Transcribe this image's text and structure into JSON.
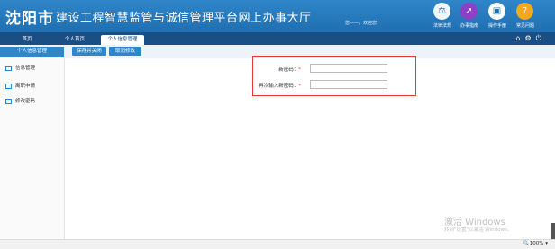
{
  "header": {
    "brand": "沈阳市",
    "title": "建设工程智慧监管与诚信管理平台网上办事大厅",
    "welcome": "您——，欢迎您！",
    "icons": [
      {
        "name": "scale-icon",
        "glyph": "⚖",
        "label": "法律法规",
        "color": "#f0f6fc",
        "glyph_color": "#1f6fb2"
      },
      {
        "name": "compass-icon",
        "glyph": "➚",
        "label": "办事指南",
        "color": "#8e3fc7",
        "glyph_color": "#ffffff"
      },
      {
        "name": "book-icon",
        "glyph": "▣",
        "label": "操作手册",
        "color": "#ffffff",
        "glyph_color": "#1f6fb2"
      },
      {
        "name": "question-icon",
        "glyph": "?",
        "label": "常见问题",
        "color": "#f4a81c",
        "glyph_color": "#ffffff"
      }
    ]
  },
  "nav": {
    "tabs": [
      "首页",
      "个人首页",
      "个人信息管理"
    ],
    "active_tab": "个人信息管理",
    "icons": [
      "home-icon",
      "gear-icon",
      "power-icon"
    ]
  },
  "sidebar": {
    "title": "个人信息管理",
    "items": [
      "信息管理",
      "离职申请",
      "修改密码"
    ]
  },
  "toolbar": {
    "save_label": "保存并关闭",
    "cancel_label": "取消修改"
  },
  "form": {
    "new_password_label": "新密码：",
    "confirm_password_label": "再次输入新密码：",
    "required_mark": "*",
    "new_password_value": "",
    "confirm_password_value": ""
  },
  "watermark": {
    "line1": "激活 Windows",
    "line2": "转到\"设置\"以激活 Windows。"
  },
  "status": {
    "zoom": "100%"
  },
  "colors": {
    "header": "#1f6fb2",
    "nav": "#1a4f86",
    "accent": "#2f86c8",
    "highlight_box": "#e53935"
  }
}
